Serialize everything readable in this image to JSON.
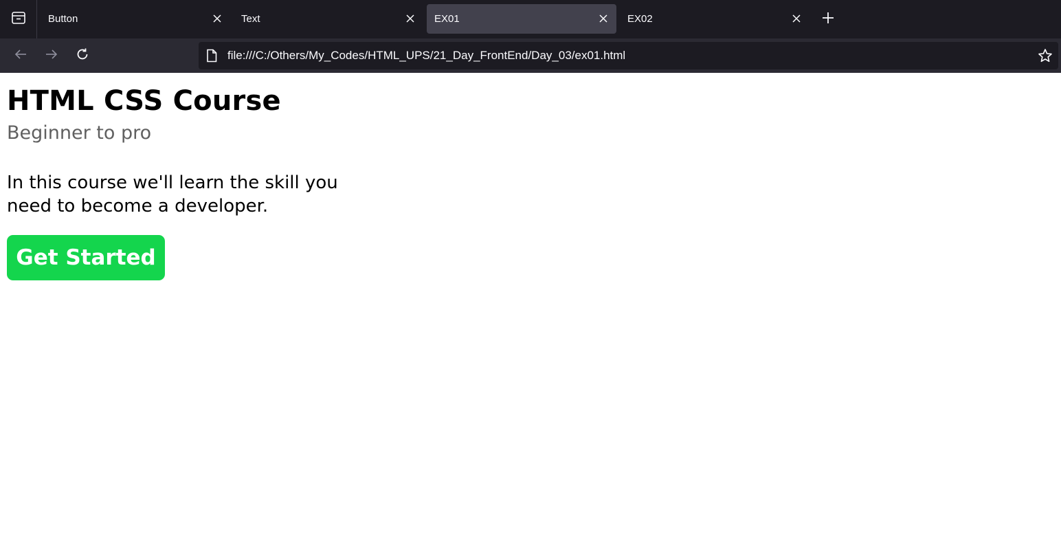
{
  "browser": {
    "tabs": [
      {
        "label": "Button",
        "active": false
      },
      {
        "label": "Text",
        "active": false
      },
      {
        "label": "EX01",
        "active": true
      },
      {
        "label": "EX02",
        "active": false
      }
    ],
    "url": "file:///C:/Others/My_Codes/HTML_UPS/21_Day_FrontEnd/Day_03/ex01.html",
    "icons": [
      "tab-list-icon",
      "close-icon",
      "new-tab-icon",
      "back-icon",
      "forward-icon",
      "reload-icon",
      "page-icon",
      "bookmark-star-icon"
    ],
    "colors": {
      "tabstrip": "#1c1b22",
      "active_tab": "#42414d",
      "navbar": "#2b2a33"
    }
  },
  "page": {
    "title": "HTML CSS Course",
    "subtitle": "Beginner to pro",
    "description": "In this course we'll learn the skill you need to become a developer.",
    "cta_label": "Get Started",
    "colors": {
      "cta_background": "#14d54d",
      "cta_text": "#ffffff",
      "subtitle": "#606060"
    }
  }
}
